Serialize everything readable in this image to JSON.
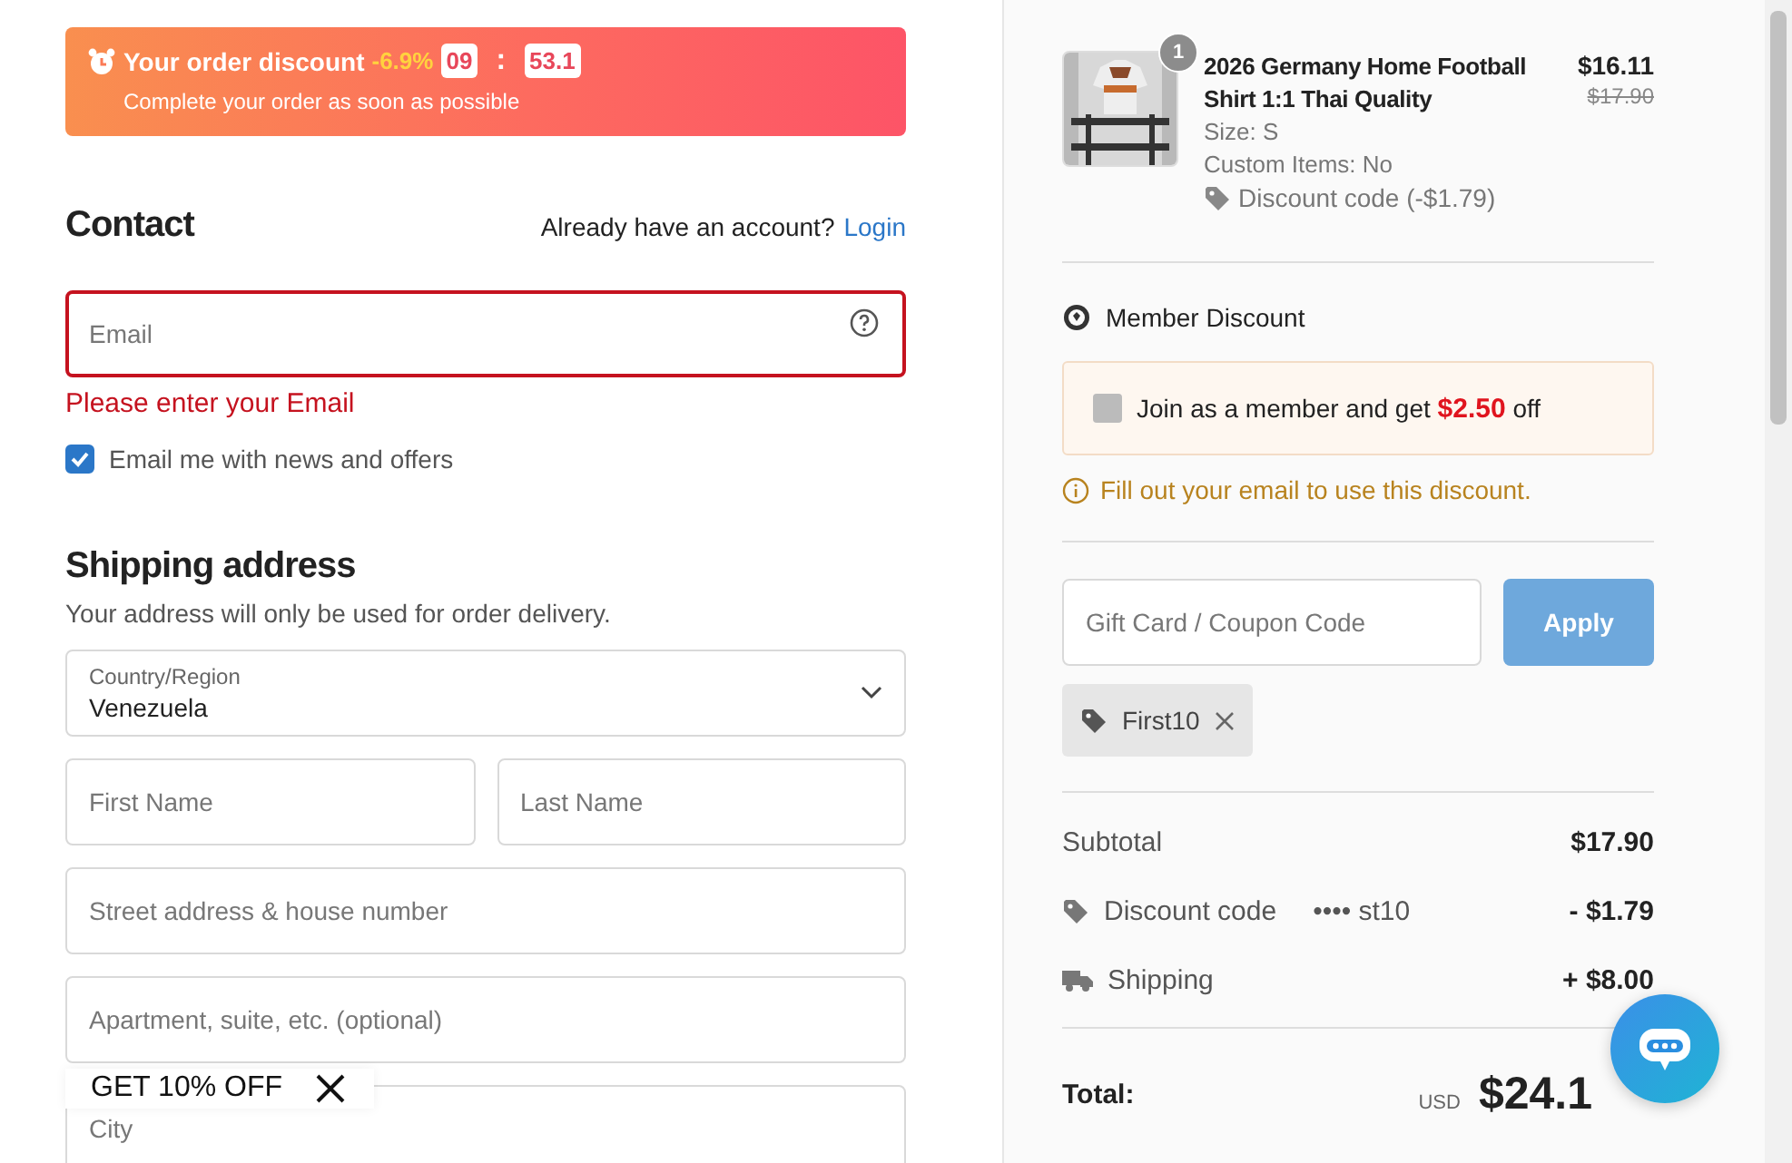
{
  "timer_banner": {
    "title": "Your order discount",
    "discount": "-6.9%",
    "minutes": "09",
    "separator": ":",
    "seconds": "53.1",
    "subtitle": "Complete your order as soon as possible"
  },
  "contact": {
    "heading": "Contact",
    "account_prompt": "Already have an account?",
    "login_link": "Login",
    "email": {
      "placeholder": "Email",
      "error": true
    },
    "error_message": "Please enter your Email",
    "newsletter": {
      "label": "Email me with news and offers",
      "checked": true
    }
  },
  "shipping": {
    "heading": "Shipping address",
    "note": "Your address will only be used for order delivery.",
    "country": {
      "label": "Country/Region",
      "value": "Venezuela"
    },
    "field_rows": [
      [
        {
          "placeholder": "First Name"
        },
        {
          "placeholder": "Last Name"
        }
      ],
      [
        {
          "placeholder": "Street address & house number"
        }
      ],
      [
        {
          "placeholder": "Apartment, suite, etc. (optional)"
        }
      ],
      [
        {
          "placeholder": "City"
        }
      ]
    ]
  },
  "popup": {
    "label": "GET 10% OFF"
  },
  "order_item": {
    "quantity": "1",
    "title": "2026 Germany Home Football Shirt 1:1 Thai Quality",
    "price": "$16.11",
    "original_price": "$17.90",
    "details": [
      "Size: S",
      "Custom Items: No"
    ],
    "discount": "Discount code (-$1.79)"
  },
  "member_discount": {
    "title": "Member Discount",
    "offer": "Join as a member and get **$2.50** off",
    "checked": false,
    "notice": "Fill out your email to use this discount."
  },
  "coupon": {
    "placeholder": "Gift Card / Coupon Code",
    "button": "Apply",
    "applied_code": "First10"
  },
  "summary": {
    "rows": [
      {
        "kind": "subtotal",
        "label": "Subtotal",
        "value": "$17.90"
      },
      {
        "kind": "discount",
        "label": "Discount code",
        "code": "•••• st10",
        "value": "- $1.79"
      },
      {
        "kind": "shipping",
        "label": "Shipping",
        "value": "+ $8.00"
      }
    ],
    "total": {
      "label": "Total:",
      "currency": "USD",
      "amount": "$24.1"
    }
  }
}
